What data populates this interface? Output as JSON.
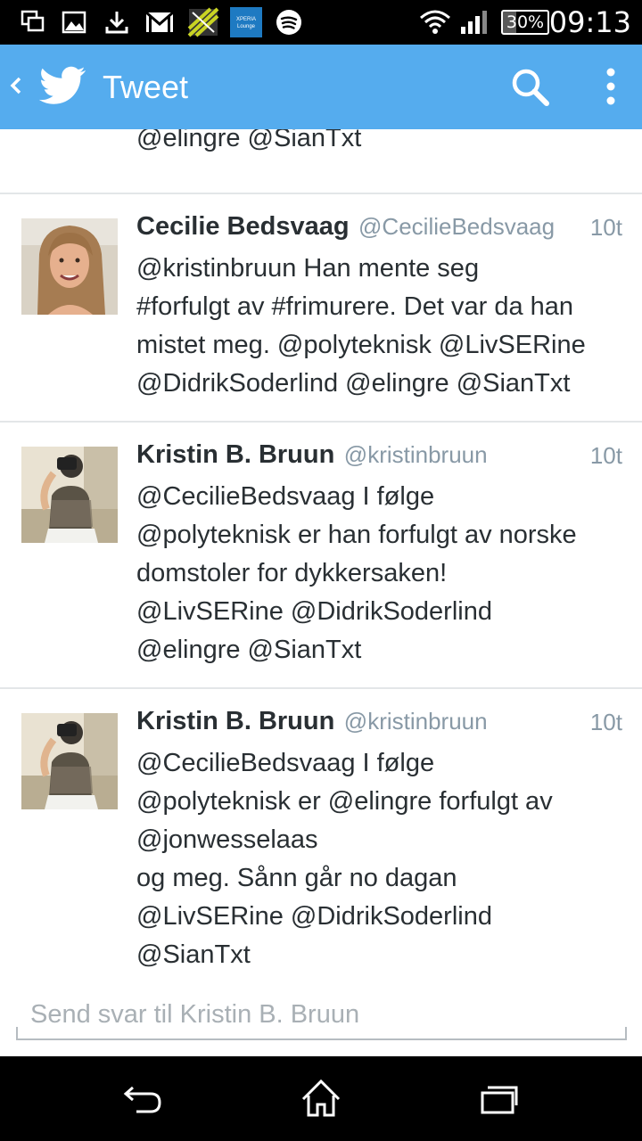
{
  "status_bar": {
    "time": "09:13",
    "battery": "30%",
    "battery_level": 0.3,
    "xperia_label": "XPERIA Lounge",
    "icons": [
      "screenshot-icon",
      "gallery-icon",
      "download-icon",
      "gmail-icon",
      "app-icon",
      "xperia-lounge-icon",
      "spotify-icon",
      "wifi-icon",
      "signal-icon",
      "battery-icon"
    ]
  },
  "action_bar": {
    "title": "Tweet",
    "back_icon": "chevron-left-icon",
    "logo_icon": "twitter-bird-icon",
    "search_icon": "search-icon",
    "menu_icon": "more-vertical-icon",
    "color": "#55acee"
  },
  "partial_tweet": {
    "lines": [
      "@elingre @SianTxt"
    ]
  },
  "tweets": [
    {
      "name": "Cecilie Bedsvaag",
      "handle": "@CecilieBedsvaag",
      "time": "10t",
      "lines": [
        "@kristinbruun Han mente seg",
        "#forfulgt av #frimurere. Det var da han",
        "mistet meg. @polyteknisk @LivSERine",
        "@DidrikSoderlind @elingre @SianTxt"
      ]
    },
    {
      "name": "Kristin B. Bruun",
      "handle": "@kristinbruun",
      "time": "10t",
      "lines": [
        "@CecilieBedsvaag I følge",
        "@polyteknisk er han forfulgt av norske",
        "domstoler for dykkersaken!",
        "@LivSERine @DidrikSoderlind",
        "@elingre @SianTxt"
      ]
    },
    {
      "name": "Kristin B. Bruun",
      "handle": "@kristinbruun",
      "time": "10t",
      "lines": [
        "@CecilieBedsvaag I følge",
        "@polyteknisk er @elingre forfulgt av",
        "@jonwesselaas",
        "og meg. Sånn går no dagan",
        "@LivSERine @DidrikSoderlind",
        "@SianTxt"
      ]
    }
  ],
  "reply": {
    "placeholder": "Send svar til Kristin B. Bruun"
  },
  "nav": {
    "back_icon": "back-icon",
    "home_icon": "home-icon",
    "recents_icon": "recent-apps-icon"
  }
}
